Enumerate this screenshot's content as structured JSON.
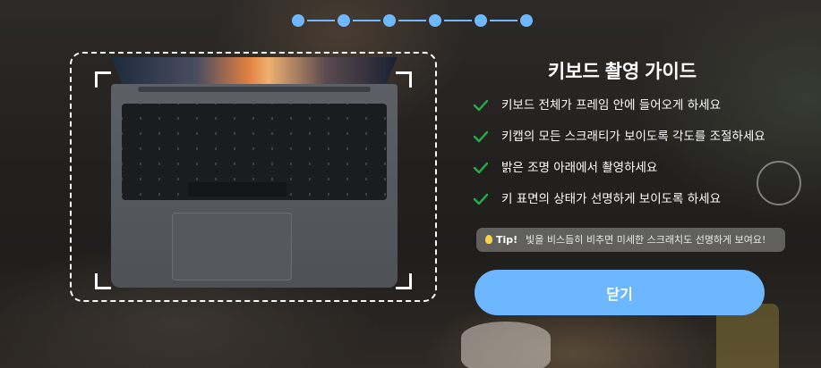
{
  "steps": {
    "count": 6,
    "current": 6,
    "color": "#6fb8ff"
  },
  "guide": {
    "title": "키보드 촬영 가이드",
    "items": [
      "키보드 전체가 프레임 안에 들어오게 하세요",
      "키캡의 모든 스크래티가 보이도록 각도를 조절하세요",
      "밝은 조명 아래에서 촬영하세요",
      "키 표면의 상태가 선명하게 보이도록 하세요"
    ],
    "check_icon": "check-icon",
    "check_color": "#22b04a"
  },
  "tip": {
    "icon": "lightbulb-icon",
    "label": "Tip!",
    "text": "빛을 비스듬히 비추면 미세한 스크래치도 선명하게 보여요!"
  },
  "close_button": {
    "label": "닫기",
    "color": "#6cb7ff"
  },
  "frame": {
    "icon": "laptop-keyboard-illustration"
  }
}
